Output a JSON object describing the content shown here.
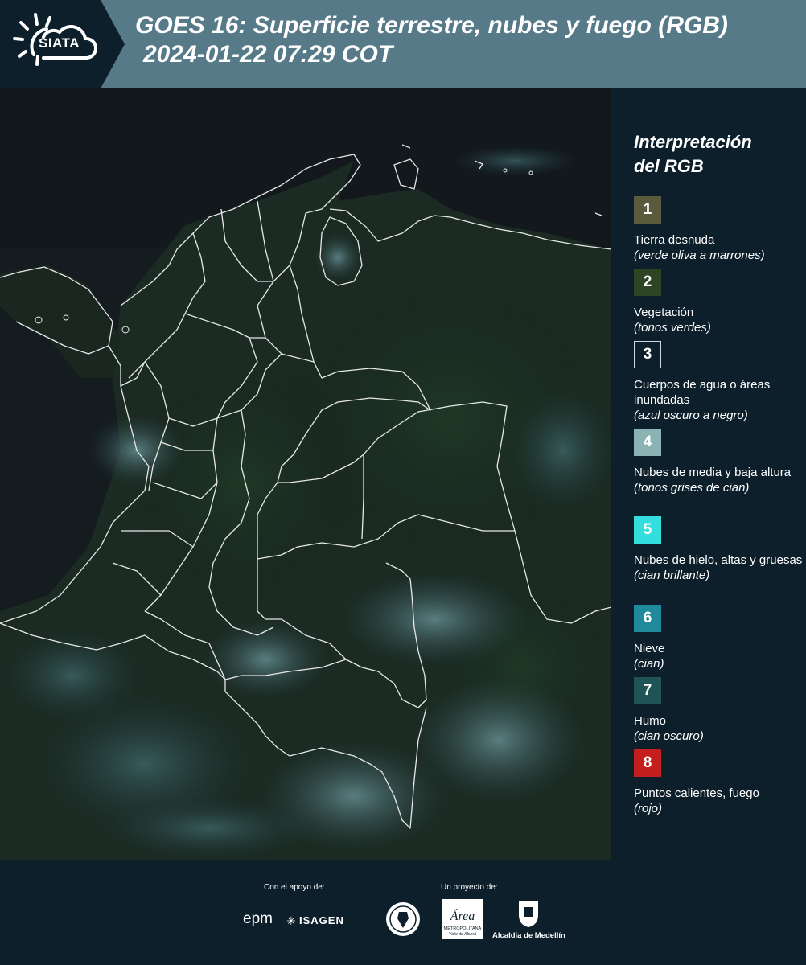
{
  "header": {
    "logo_text": "SIATA",
    "title_line1": "GOES 16: Superficie terrestre, nubes y fuego (RGB)",
    "title_line2": "2024-01-22 07:29 COT"
  },
  "legend": {
    "title_line1": "Interpretación",
    "title_line2": "del RGB",
    "items": [
      {
        "number": "1",
        "label": "Tierra desnuda",
        "sub": "(verde oliva a marrones)",
        "color": "#5a5b3c"
      },
      {
        "number": "2",
        "label": "Vegetación",
        "sub": "(tonos verdes)",
        "color": "#2e4424"
      },
      {
        "number": "3",
        "label": "Cuerpos de agua o áreas inundadas",
        "sub": "(azul oscuro a negro)",
        "color": "#0c1f2b"
      },
      {
        "number": "4",
        "label": "Nubes de media y baja altura",
        "sub": "(tonos grises de cian)",
        "color": "#8bb3b4"
      },
      {
        "number": "5",
        "label": "Nubes de hielo, altas y gruesas",
        "sub": "(cian brillante)",
        "color": "#35dede"
      },
      {
        "number": "6",
        "label": "Nieve",
        "sub": "(cian)",
        "color": "#1f8a9c"
      },
      {
        "number": "7",
        "label": "Humo",
        "sub": "(cian oscuro)",
        "color": "#1e5456"
      },
      {
        "number": "8",
        "label": "Puntos calientes, fuego",
        "sub": "(rojo)",
        "color": "#c41e1e"
      }
    ]
  },
  "footer": {
    "support_label": "Con el apoyo de:",
    "project_label": "Un proyecto de:",
    "sponsors": {
      "epm": "epm",
      "isagen": "ISAGEN",
      "area_name": "Área",
      "area_sub1": "METROPOLITANA",
      "area_sub2": "Valle de Aburrá",
      "alcaldia": "Alcaldía de Medellín"
    }
  },
  "colors": {
    "background": "#0c1f2b",
    "header_band": "#567a88",
    "border_lines": "#e8e8e8"
  }
}
